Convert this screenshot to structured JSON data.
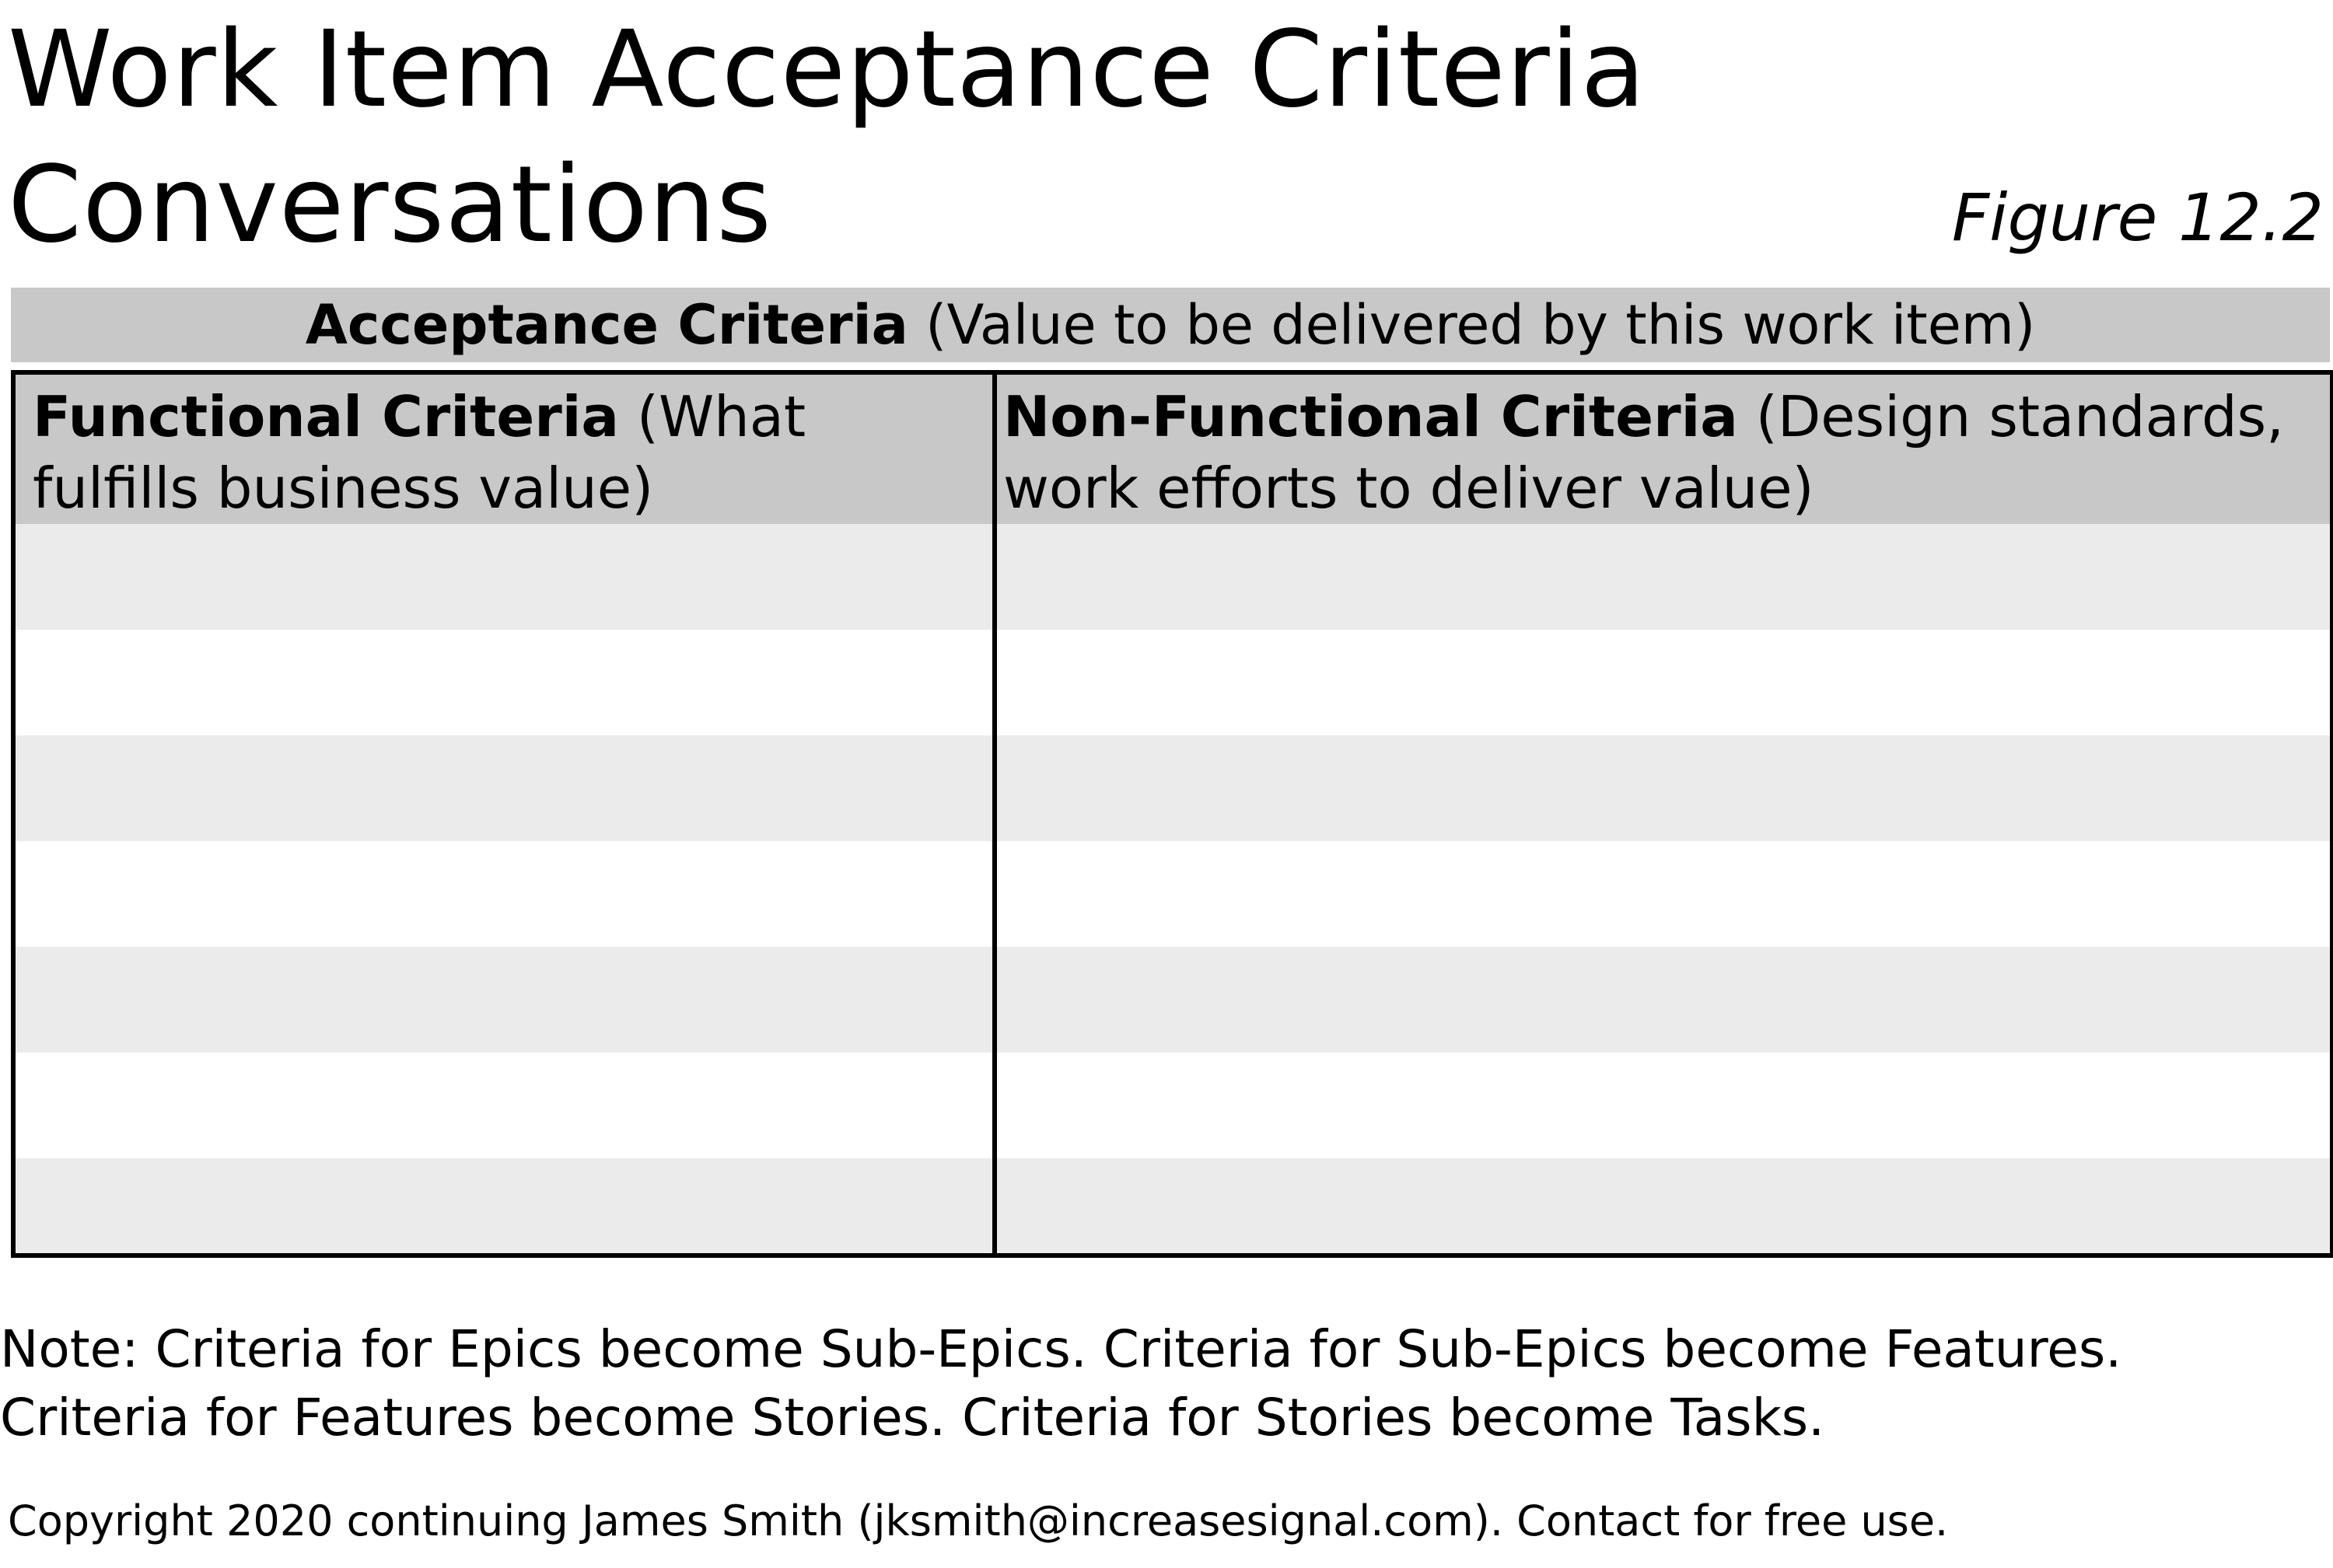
{
  "title": {
    "line1": "Work Item Acceptance Criteria",
    "line2": "Conversations"
  },
  "figure_label": "Figure 12.2",
  "acceptance_banner": {
    "bold": "Acceptance Criteria",
    "rest": " (Value to be delivered by this work item)"
  },
  "table": {
    "functional": {
      "bold": "Functional Criteria",
      "rest": " (What fulfills business value)"
    },
    "non_functional": {
      "bold": "Non-Functional Criteria",
      "rest": " (Design standards, work efforts to deliver value)"
    },
    "colors": {
      "header": "#c8c8c8",
      "stripe": "#ebebeb",
      "border": "#000000"
    }
  },
  "note": {
    "line1": "Note: Criteria for Epics become Sub-Epics. Criteria for Sub-Epics become Features.",
    "line2": "Criteria for Features become Stories. Criteria for Stories become Tasks."
  },
  "copyright": "Copyright 2020 continuing James Smith (jksmith@increasesignal.com). Contact for free use."
}
